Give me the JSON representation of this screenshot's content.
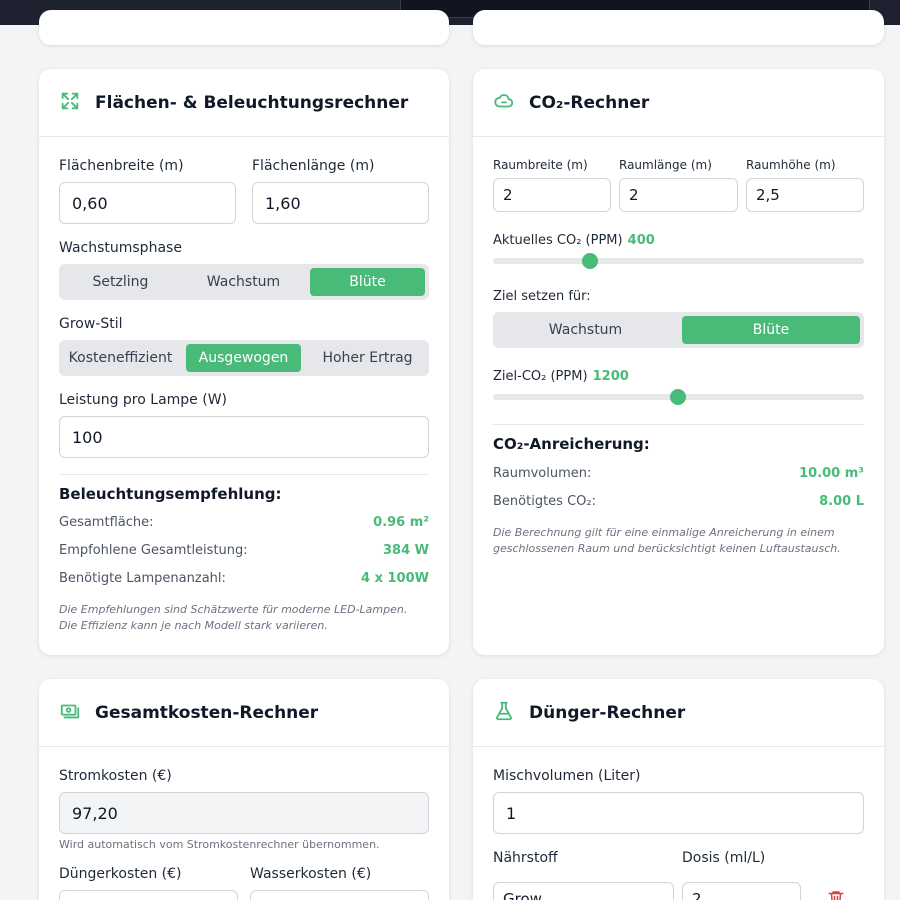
{
  "colors": {
    "accent": "#48bb78",
    "topbar": "#1e2230"
  },
  "lighting": {
    "title": "Flächen- & Beleuchtungsrechner",
    "icon": "expand-icon",
    "width_label": "Flächenbreite (m)",
    "width_value": "0,60",
    "length_label": "Flächenlänge (m)",
    "length_value": "1,60",
    "phase_label": "Wachstumsphase",
    "phases": [
      "Setzling",
      "Wachstum",
      "Blüte"
    ],
    "phase_selected": "Blüte",
    "style_label": "Grow-Stil",
    "styles": [
      "Kosteneffizient",
      "Ausgewogen",
      "Hoher Ertrag"
    ],
    "style_selected": "Ausgewogen",
    "power_label": "Leistung pro Lampe (W)",
    "power_value": "100",
    "result_title": "Beleuchtungsempfehlung:",
    "results": [
      {
        "label": "Gesamtfläche:",
        "value": "0.96 m²"
      },
      {
        "label": "Empfohlene Gesamtleistung:",
        "value": "384 W"
      },
      {
        "label": "Benötigte Lampenanzahl:",
        "value": "4 x 100W"
      }
    ],
    "note": "Die Empfehlungen sind Schätzwerte für moderne LED-Lampen. Die Effizienz kann je nach Modell stark variieren."
  },
  "co2": {
    "title": "CO₂-Rechner",
    "icon": "cloud-icon",
    "room_width_label": "Raumbreite (m)",
    "room_width_value": "2",
    "room_length_label": "Raumlänge (m)",
    "room_length_value": "2",
    "room_height_label": "Raumhöhe (m)",
    "room_height_value": "2,5",
    "current_label": "Aktuelles CO₂ (PPM)",
    "current_value": "400",
    "current_level": 400,
    "target_for_label": "Ziel setzen für:",
    "targets": [
      "Wachstum",
      "Blüte"
    ],
    "target_selected": "Blüte",
    "target_co2_label": "Ziel-CO₂ (PPM)",
    "target_co2_value": "1200",
    "target_level": 1200,
    "result_title": "CO₂-Anreicherung:",
    "results": [
      {
        "label": "Raumvolumen:",
        "value": "10.00 m³"
      },
      {
        "label": "Benötigtes CO₂:",
        "value": "8.00 L"
      }
    ],
    "note": "Die Berechnung gilt für eine einmalige Anreicherung in einem geschlossenen Raum und berücksichtigt keinen Luftaustausch."
  },
  "costs": {
    "title": "Gesamtkosten-Rechner",
    "icon": "money-icon",
    "power_cost_label": "Stromkosten (€)",
    "power_cost_value": "97,20",
    "power_cost_hint": "Wird automatisch vom Stromkostenrechner übernommen.",
    "fertilizer_cost_label": "Düngerkosten (€)",
    "water_cost_label": "Wasserkosten (€)"
  },
  "fertilizer": {
    "title": "Dünger-Rechner",
    "icon": "flask-icon",
    "volume_label": "Mischvolumen (Liter)",
    "volume_value": "1",
    "nutrient_label": "Nährstoff",
    "dose_label": "Dosis (ml/L)",
    "nutrient_value": "Grow",
    "dose_value": "2",
    "delete_icon": "trash-icon"
  }
}
